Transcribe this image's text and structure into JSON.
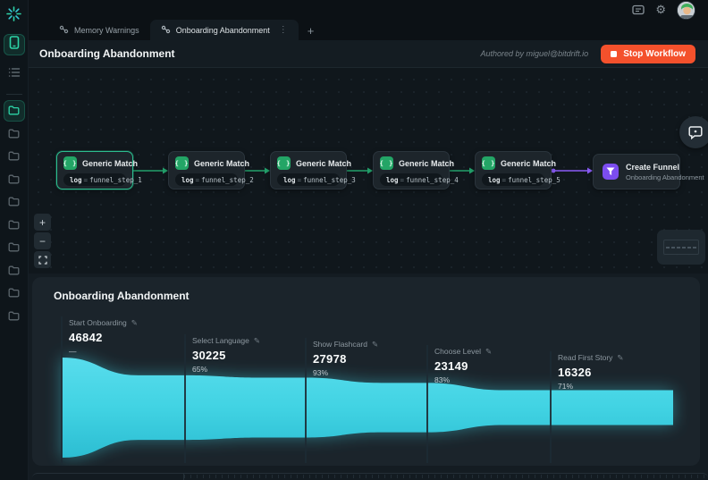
{
  "colors": {
    "accent_teal": "#2dd4a7",
    "funnel_cyan": "#41d3e3",
    "stop_red": "#f4512c",
    "edge_green": "#23a06b",
    "edge_purple": "#8a5cf6",
    "node_icon_green": "#23a566",
    "node_icon_purple": "#7c4df0"
  },
  "sidebar": {
    "folder_count": 10,
    "active_folder_index": 0
  },
  "topbar": {
    "tabs": [
      {
        "label": "Memory Warnings",
        "active": false
      },
      {
        "label": "Onboarding Abandonment",
        "active": true
      }
    ],
    "kebab_glyph": "⋮",
    "add_tab_glyph": "+",
    "gear_glyph": "⚙"
  },
  "header": {
    "title": "Onboarding Abandonment",
    "authored_by": "Authored by miguel@bitdrift.io",
    "stop_label": "Stop Workflow"
  },
  "workflow": {
    "match_nodes": [
      {
        "title": "Generic Match",
        "pill_key": "log",
        "pill_op": "=",
        "pill_value": "funnel_step_1",
        "selected": true
      },
      {
        "title": "Generic Match",
        "pill_key": "log",
        "pill_op": "=",
        "pill_value": "funnel_step_2",
        "selected": false
      },
      {
        "title": "Generic Match",
        "pill_key": "log",
        "pill_op": "=",
        "pill_value": "funnel_step_3",
        "selected": false
      },
      {
        "title": "Generic Match",
        "pill_key": "log",
        "pill_op": "=",
        "pill_value": "funnel_step_4",
        "selected": false
      },
      {
        "title": "Generic Match",
        "pill_key": "log",
        "pill_op": "=",
        "pill_value": "funnel_step_5",
        "selected": false
      }
    ],
    "output_node": {
      "title": "Create Funnel",
      "subtitle": "Onboarding Abandonment"
    },
    "zoom_controls": {
      "zoom_in": "+",
      "zoom_out": "−"
    }
  },
  "chart_data": {
    "type": "area",
    "subtype": "funnel",
    "title": "Onboarding Abandonment",
    "color": "#41d3e3",
    "steps": [
      {
        "label": "Start Onboarding",
        "value": 46842,
        "percent": "—"
      },
      {
        "label": "Select Language",
        "value": 30225,
        "percent": "65%"
      },
      {
        "label": "Show Flashcard",
        "value": 27978,
        "percent": "93%"
      },
      {
        "label": "Choose Level",
        "value": 23149,
        "percent": "83%"
      },
      {
        "label": "Read First Story",
        "value": 16326,
        "percent": "71%"
      }
    ],
    "edit_glyph": "✎"
  }
}
